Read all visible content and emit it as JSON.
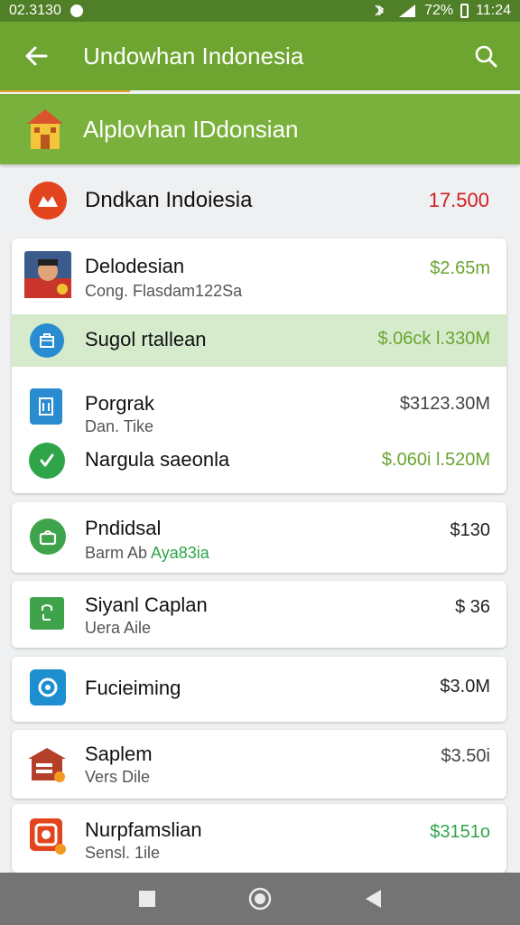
{
  "status_bar": {
    "time_left": "02.3130",
    "battery_text": "72%",
    "time_right": "11:24"
  },
  "app_bar": {
    "title": "Undowhan Indonesia"
  },
  "section_header": {
    "title": "Alplovhan IDdonsian"
  },
  "summary": {
    "name": "Dndkan Indoiesia",
    "value": "17.500"
  },
  "items": [
    {
      "title": "Delodesian",
      "subtitle": "Cong. Flasdam122Sa",
      "amount": "$2.65m",
      "amount_color": "#6aa531"
    },
    {
      "title": "Sugol rtallean",
      "amount": "$.06ck l.330M",
      "highlighted": true
    },
    {
      "title": "Porgrak",
      "subtitle": "Dan. Tike",
      "amount": "$3123.30M"
    },
    {
      "title": "Nargula saeonla",
      "amount": "$.060i l.520M"
    },
    {
      "title": "Pndidsal",
      "subtitle_prefix": "Barm Ab",
      "subtitle_accent": "Aya83ia",
      "amount": "$130"
    },
    {
      "title": "Siyanl Caplan",
      "subtitle": "Uera Aile",
      "amount": "$ 36"
    },
    {
      "title": "Fucieiming",
      "amount": "$3.0M"
    },
    {
      "title": "Saplem",
      "subtitle": "Vers Dile",
      "amount": "$3.50i"
    },
    {
      "title": "Nurpfamslian",
      "subtitle": "Sensl. 1ile",
      "amount": "$3151o",
      "amount_color": "#2fa54a"
    }
  ],
  "colors": {
    "primary": "#6ea531",
    "status_bar": "#4f7f27",
    "accent_green": "#6aa531",
    "negative": "#cf2020",
    "highlight": "#d6ebcc"
  },
  "icons": [
    "back-arrow-icon",
    "search-icon",
    "house-icon",
    "brand-logo-icon",
    "briefcase-icon",
    "phone-icon",
    "check-icon",
    "bag-icon",
    "shopping-bag-icon",
    "chat-icon",
    "store-icon",
    "camera-icon",
    "square-nav-icon",
    "circle-nav-icon",
    "triangle-nav-icon"
  ]
}
